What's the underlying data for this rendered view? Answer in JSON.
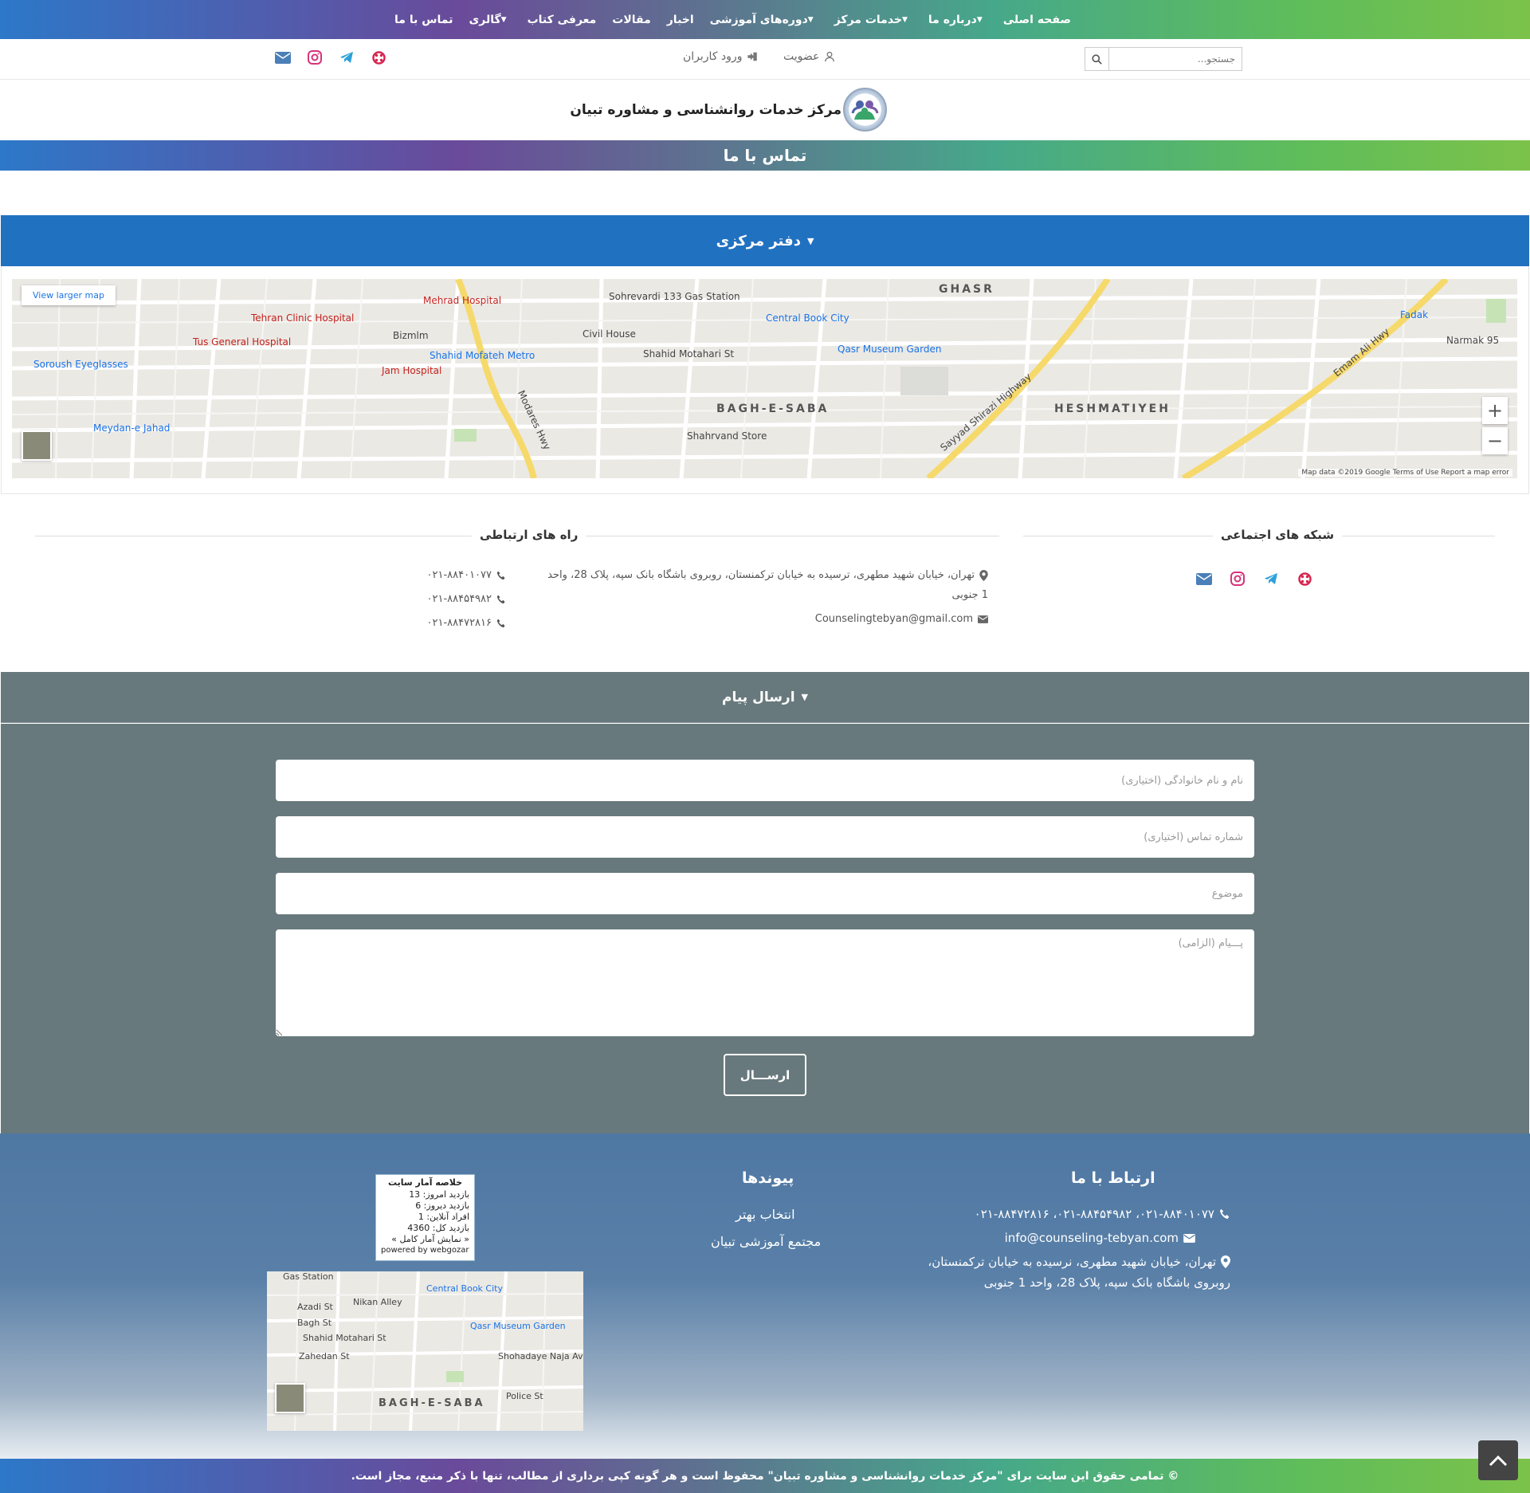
{
  "nav": {
    "items": [
      {
        "label": "صفحه اصلی",
        "dropdown": false
      },
      {
        "label": "درباره ما",
        "dropdown": true
      },
      {
        "label": "خدمات مرکز",
        "dropdown": true
      },
      {
        "label": "دوره‌های آموزشی",
        "dropdown": true
      },
      {
        "label": "اخبار",
        "dropdown": false
      },
      {
        "label": "مقالات",
        "dropdown": false
      },
      {
        "label": "معرفی کتاب",
        "dropdown": false
      },
      {
        "label": "گالری",
        "dropdown": true
      },
      {
        "label": "تماس با ما",
        "dropdown": false
      }
    ]
  },
  "topbar": {
    "search_placeholder": "جستجو...",
    "signup_label": "عضویت",
    "login_label": "ورود کاربران"
  },
  "brand": {
    "name": "مرکز خدمات روانشناسی و مشاوره تبیان"
  },
  "page": {
    "title": "تماس با ما"
  },
  "office": {
    "heading": "دفتر مرکزی",
    "map": {
      "view_larger": "View larger map",
      "credit": "Map data ©2019 Google    Terms of Use    Report a map error",
      "zoom_in": "+",
      "zoom_out": "−",
      "labels": [
        "Tehran Clinic Hospital",
        "Tus General Hospital",
        "Soroush Eyeglasses",
        "Meydan-e Jahad",
        "Mehrad Hospital",
        "Bizmlm",
        "Shahid Mofateh Metro",
        "Jam Hospital",
        "Civil House",
        "Sohrevardi 133 Gas Station",
        "Central Book City",
        "Qasr Museum Garden",
        "BAGH-E-SABA",
        "Shahrvand Store",
        "HESHMATIYEH",
        "Sayyad Shirazi Highway",
        "Emam Ali Hwy",
        "Fadak",
        "Narmak 95",
        "GHASR",
        "Shahid Motahari St",
        "Modares Hwy"
      ]
    }
  },
  "social_section": {
    "title": "شبکه های اجتماعی"
  },
  "contact_section": {
    "title": "راه های ارتباطی",
    "address": "تهران، خیابان شهید مطهری، ترسیده به خیابان ترکمنستان، روبروی باشگاه بانک سپه، پلاک 28، واحد",
    "address_line2": "1 جنوبی",
    "email": "Counselingtebyan@gmail.com",
    "phones": [
      "۰۲۱-۸۸۴۰۱۰۷۷",
      "۰۲۱-۸۸۴۵۴۹۸۲",
      "۰۲۱-۸۸۴۷۲۸۱۶"
    ]
  },
  "message_form": {
    "heading": "ارسال پیام",
    "name_placeholder": "نام و نام خانوادگی (اختیاری)",
    "phone_placeholder": "شماره تماس (اختیاری)",
    "subject_placeholder": "موضوع",
    "message_placeholder": "پـــیام (الزامی)",
    "submit_label": "ارســـال"
  },
  "footer": {
    "contact_title": "ارتباط با ما",
    "phones_line": "۰۲۱-۸۸۴۰۱۰۷۷، ۰۲۱-۸۸۴۵۴۹۸۲، ۰۲۱-۸۸۴۷۲۸۱۶",
    "email": "info@counseling-tebyan.com",
    "address_line1": "تهران، خیابان شهید مطهری، نرسیده به خیابان ترکمنستان،",
    "address_line2": "روبروی باشگاه بانک سپه، پلاک 28، واحد 1 جنوبی",
    "links_title": "پیوندها",
    "links": [
      "انتخاب بهتر",
      "مجتمع آموزشی تبیان"
    ],
    "stats": {
      "heading": "خلاصه آمار سایت",
      "today": "بازدید امروز: 13",
      "yesterday": "بازدید دیروز: 6",
      "online": "افراد آنلاین: 1",
      "total": "بازدید کل: 4360",
      "more": "« نمایش آمار کامل »",
      "powered": "powered by webgozar"
    },
    "mini_map_labels": [
      "Gas Station",
      "Central Book City",
      "Qasr Museum Garden",
      "Shahid Motahari St",
      "BAGH-E-SABA",
      "Police St",
      "Shohadaye Naja Ave",
      "Azadi St",
      "Nikan Alley",
      "Bagh St",
      "Zahedan St"
    ]
  },
  "copyright": "© تمامی حقوق این سایت برای \"مرکز خدمات روانشناسی و مشاوره تبیان\" محفوظ است و هر گونه کپی برداری از مطالب، تنها با ذکر منبع، مجاز است.",
  "colors": {
    "office_header": "#2171c1",
    "form_bg": "#68797d",
    "telegram": "#2ea0d8",
    "instagram": "#d6337a",
    "email_icon": "#4a7fb8",
    "aparat": "#d6264f"
  }
}
